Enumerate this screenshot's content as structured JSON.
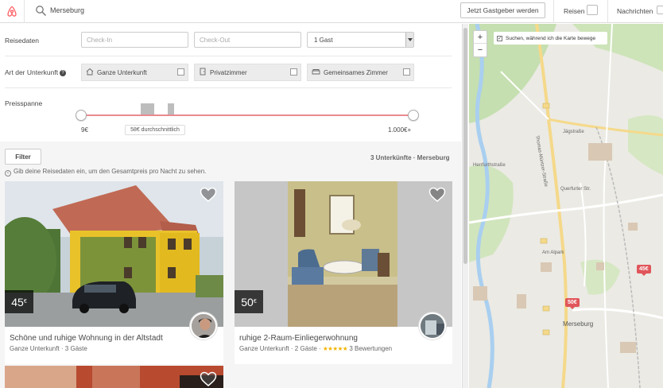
{
  "header": {
    "location": "Merseburg",
    "host_button": "Jetzt Gastgeber werden",
    "nav_trips": "Reisen",
    "nav_messages": "Nachrichten"
  },
  "dates": {
    "label": "Reisedaten",
    "checkin_placeholder": "Check-In",
    "checkout_placeholder": "Check-Out",
    "guests_value": "1 Gast"
  },
  "room_type": {
    "label": "Art der Unterkunft",
    "options": [
      "Ganze Unterkunft",
      "Privatzimmer",
      "Gemeinsames Zimmer"
    ]
  },
  "price": {
    "label": "Preisspanne",
    "min": "9€",
    "max": "1.000€+",
    "average": "58€ durchschnittlich"
  },
  "results": {
    "filter_button": "Filter",
    "count": "3 Unterkünfte · Merseburg",
    "hint": "Gib deine Reisedaten ein, um den Gesamtpreis pro Nacht zu sehen."
  },
  "listings": [
    {
      "price": "45",
      "currency": "€",
      "title": "Schöne und ruhige Wohnung in der Altstadt",
      "subtitle": "Ganze Unterkunft · 3 Gäste"
    },
    {
      "price": "50",
      "currency": "€",
      "title": "ruhige 2-Raum-Einliegerwohnung",
      "subtitle": "Ganze Unterkunft · 2 Gäste ·",
      "rating": 5,
      "reviews": "3 Bewertungen"
    }
  ],
  "map": {
    "zoom_in": "+",
    "zoom_out": "−",
    "search_as_move": "Suchen, während ich die Karte bewege",
    "checkbox_mark": "✓",
    "pins": [
      "45€",
      "50€"
    ],
    "city_label": "Merseburg",
    "street_labels": [
      "Thomas-Müntzer-Straße",
      "Querfurter Str.",
      "Herrfurthstraße",
      "Jägstraße",
      "Am Alpark",
      "Merseburg"
    ]
  },
  "colors": {
    "brand": "#FF5A5F",
    "slider": "#e98a8f",
    "pin": "#e0565b",
    "star": "#f4b400"
  }
}
